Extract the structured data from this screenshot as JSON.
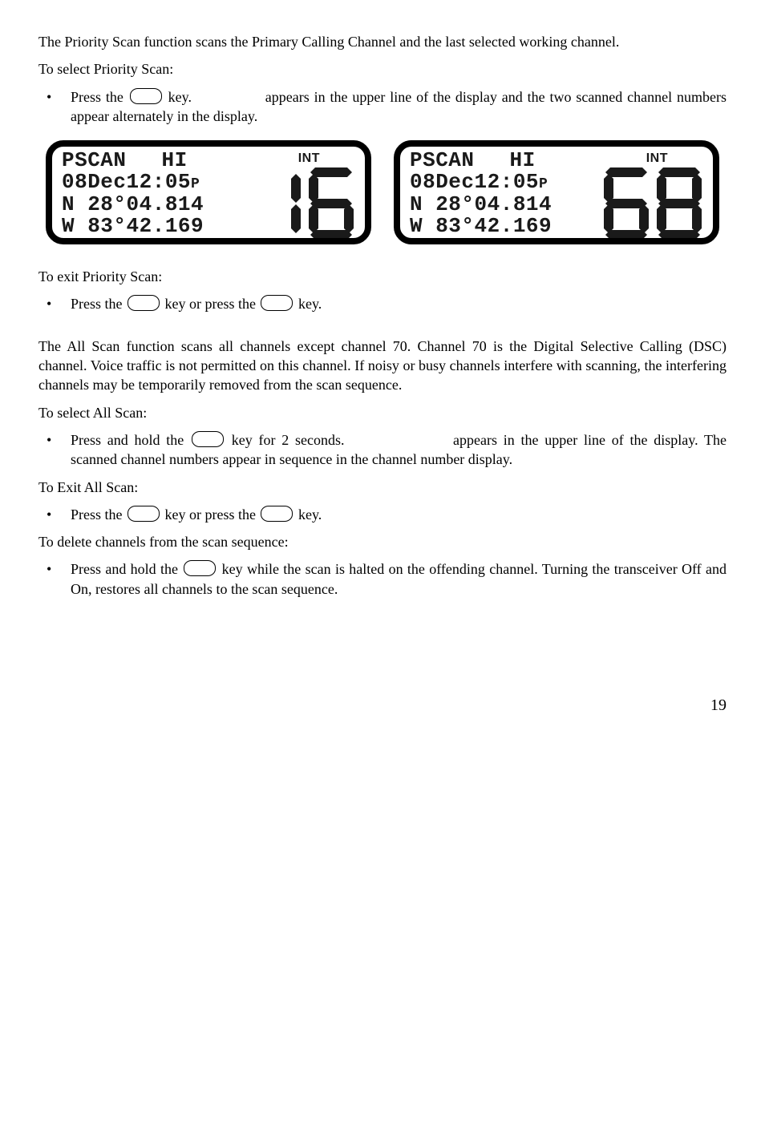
{
  "priorityScan": {
    "intro": "The Priority Scan function scans the Primary Calling Channel and the last selected working channel.",
    "toSelect": "To select Priority Scan:",
    "press1a": "Press the ",
    "press1b": " key.",
    "press1c": "appears in the upper line of the display and the two scanned channel numbers appear alternately in the display.",
    "toExit": "To exit Priority Scan:",
    "press2a": "Press the ",
    "press2b": " key or press the ",
    "press2c": " key."
  },
  "lcd": {
    "row1a": "PSCAN",
    "row1b": "HI",
    "row2a": "08Dec12:05",
    "row2p": "P",
    "row3": "N 28°04.814",
    "row4": "W 83°42.169",
    "intLabel": "INT",
    "digitsLeft": "16",
    "digitsRight": "68"
  },
  "allScan": {
    "intro": "The All Scan function scans all channels except channel 70.  Channel 70 is the Digital Selective Calling (DSC) channel.  Voice traffic is not permitted on this channel.  If noisy or busy channels interfere with scanning, the interfering channels may be temporarily removed from the scan sequence.",
    "toSelect": "To select All Scan:",
    "press1a": "Press and hold the ",
    "press1b": " key for 2 seconds.",
    "press1c": "appears in the upper line of the display.  The scanned channel numbers appear in sequence in the channel number display.",
    "toExit": "To Exit All Scan:",
    "press2a": "Press the ",
    "press2b": " key or press the ",
    "press2c": " key.",
    "toDelete": "To delete channels from the scan sequence:",
    "press3a": "Press and hold the ",
    "press3b": " key while the scan is halted on the offending channel.  Turning the transceiver Off and On, restores all channels to the scan sequence."
  },
  "pageNumber": "19"
}
